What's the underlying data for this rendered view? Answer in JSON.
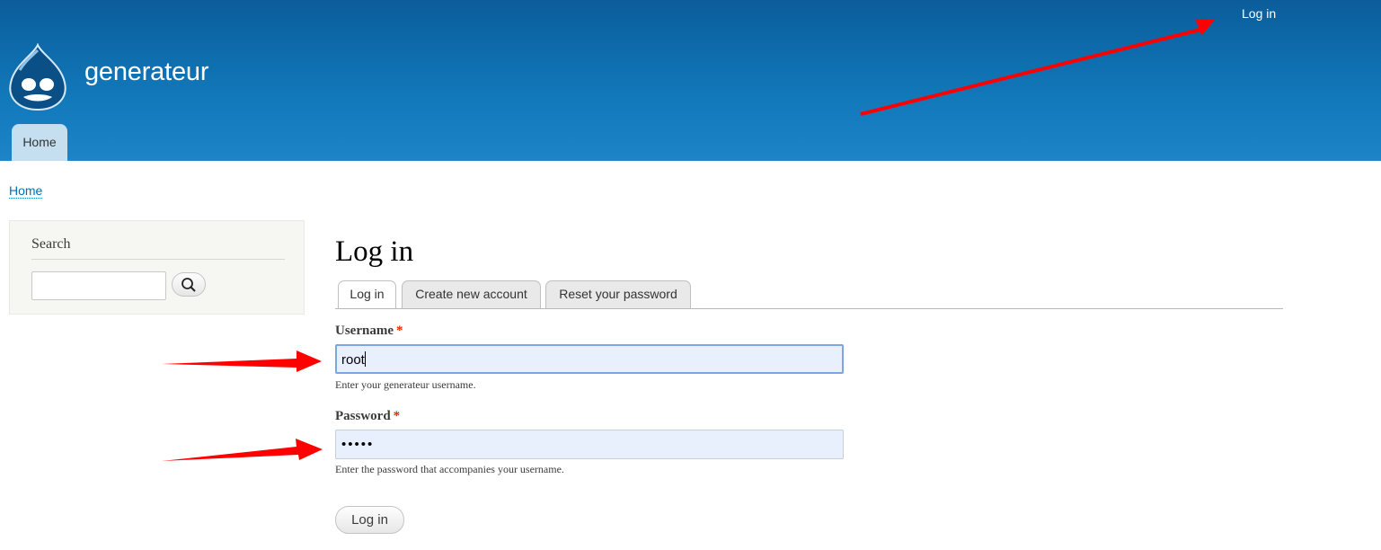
{
  "site": {
    "name": "generateur",
    "logo_icon": "drupal-drop-icon"
  },
  "header": {
    "secondary_menu_login": "Log in",
    "main_menu": [
      {
        "label": "Home"
      }
    ]
  },
  "breadcrumb": {
    "home": "Home"
  },
  "sidebar": {
    "search_title": "Search",
    "search_value": "",
    "search_icon": "search-icon"
  },
  "main": {
    "title": "Log in",
    "tabs": [
      {
        "label": "Log in",
        "active": true
      },
      {
        "label": "Create new account",
        "active": false
      },
      {
        "label": "Reset your password",
        "active": false
      }
    ],
    "username": {
      "label": "Username",
      "required_marker": "*",
      "value": "root",
      "description": "Enter your generateur username."
    },
    "password": {
      "label": "Password",
      "required_marker": "*",
      "value": "•••••",
      "description": "Enter the password that accompanies your username."
    },
    "submit_label": "Log in"
  },
  "colors": {
    "header_top": "#0b5d9a",
    "header_bottom": "#1d84c8",
    "link": "#0071b3",
    "required": "#e32700",
    "annotation_arrow": "#ff0000",
    "autofill_bg": "#e8f0fe"
  }
}
